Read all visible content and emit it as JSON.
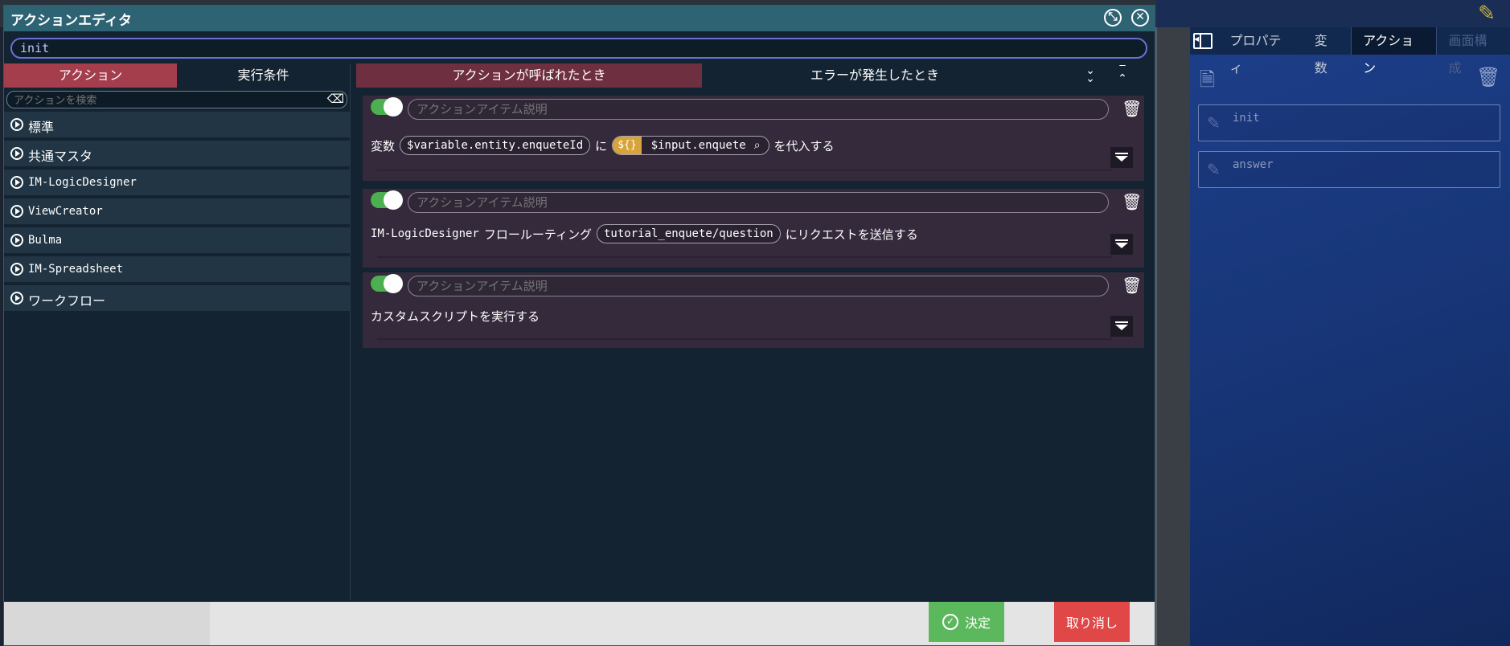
{
  "dialog": {
    "title": "アクションエディタ",
    "search_value": "init",
    "left_tabs": [
      "アクション",
      "実行条件"
    ],
    "left_search_placeholder": "アクションを検索",
    "categories": [
      "標準",
      "共通マスタ",
      "IM-LogicDesigner",
      "ViewCreator",
      "Bulma",
      "IM-Spreadsheet",
      "ワークフロー"
    ],
    "event_tabs": [
      "アクションが呼ばれたとき",
      "エラーが発生したとき"
    ],
    "item_desc_placeholder": "アクションアイテム説明",
    "items": [
      {
        "prefix": "変数",
        "target": "$variable.entity.enqueteId",
        "mid": "に",
        "expr_type": "${}",
        "expr_value": "$input.enquete",
        "suffix": "を代入する"
      },
      {
        "prefix": "IM-LogicDesigner",
        "label": "フロールーティング",
        "route": "tutorial_enquete/question",
        "suffix": "にリクエストを送信する"
      },
      {
        "text": "カスタムスクリプトを実行する"
      }
    ],
    "ok_label": "決定",
    "cancel_label": "取り消し"
  },
  "right_panel": {
    "tabs": [
      "プロパティ",
      "変数",
      "アクション",
      "画面構成"
    ],
    "actions": [
      "init",
      "answer"
    ]
  },
  "colors": {
    "title_bar": "#2e6374",
    "active_left_tab": "#a43e4d",
    "active_event_tab": "#6e2f40",
    "ok": "#5cb85c",
    "cancel": "#e04848",
    "toggle_on": "#4caf50",
    "expr_badge": "#d6a43b"
  }
}
